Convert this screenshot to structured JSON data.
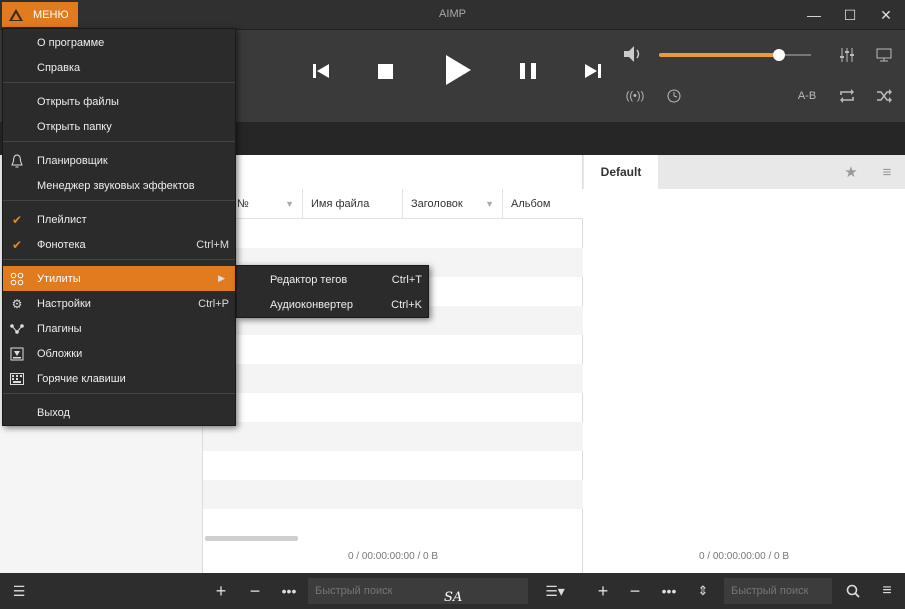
{
  "window": {
    "title": "AIMP",
    "menu_label": "МЕНЮ",
    "minimize": "—",
    "maximize": "☐",
    "close": "✕"
  },
  "player": {
    "ab_label": "A-B"
  },
  "playlist": {
    "columns": [
      "№",
      "Имя файла",
      "Заголовок",
      "Альбом"
    ],
    "status": "0 / 00:00:00:00 / 0 B"
  },
  "right_panel": {
    "tab": "Default",
    "status": "0 / 00:00:00:00 / 0 B"
  },
  "bottom": {
    "search_placeholder_1": "Быстрый поиск",
    "search_placeholder_2": "Быстрый поиск",
    "watermark": "SA"
  },
  "menu": {
    "items": [
      {
        "label": "О программе",
        "shortcut": ""
      },
      {
        "label": "Справка",
        "shortcut": ""
      },
      {
        "label": "Открыть файлы",
        "shortcut": ""
      },
      {
        "label": "Открыть папку",
        "shortcut": ""
      },
      {
        "label": "Планировщик",
        "shortcut": ""
      },
      {
        "label": "Менеджер звуковых эффектов",
        "shortcut": ""
      },
      {
        "label": "Плейлист",
        "shortcut": ""
      },
      {
        "label": "Фонотека",
        "shortcut": "Ctrl+M"
      },
      {
        "label": "Утилиты",
        "shortcut": ""
      },
      {
        "label": "Настройки",
        "shortcut": "Ctrl+P"
      },
      {
        "label": "Плагины",
        "shortcut": ""
      },
      {
        "label": "Обложки",
        "shortcut": ""
      },
      {
        "label": "Горячие клавиши",
        "shortcut": ""
      },
      {
        "label": "Выход",
        "shortcut": ""
      }
    ]
  },
  "submenu": {
    "items": [
      {
        "label": "Редактор тегов",
        "shortcut": "Ctrl+T"
      },
      {
        "label": "Аудиоконвертер",
        "shortcut": "Ctrl+K"
      }
    ]
  },
  "volume": {
    "level": 0.79
  },
  "colors": {
    "accent": "#e07b20",
    "volume_fill": "#e99a40"
  }
}
